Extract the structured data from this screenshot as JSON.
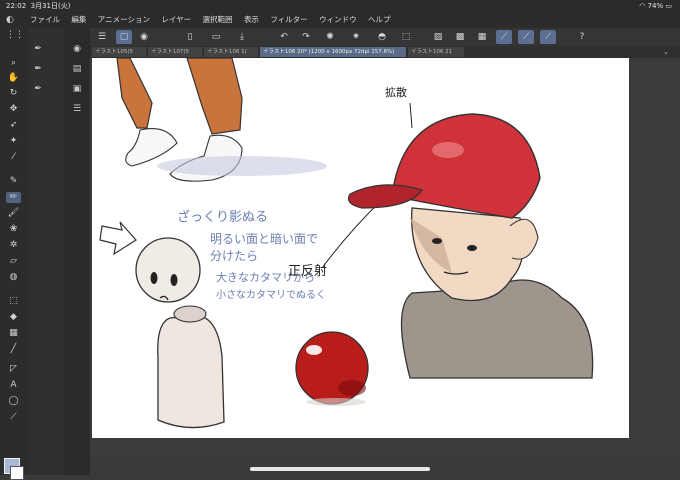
{
  "status": {
    "time": "22:02",
    "date": "3月31日(火)",
    "battery": "74%"
  },
  "menu": {
    "items": [
      "ファイル",
      "編集",
      "アニメーション",
      "レイヤー",
      "選択範囲",
      "表示",
      "フィルター",
      "ウィンドウ",
      "ヘルプ"
    ]
  },
  "tabs": [
    "イラスト105(5",
    "イラスト107(5",
    "イラスト106 1(",
    "イラスト106 20* (1200 x 1600px 72dpi 157.6%)",
    "イラスト106 21"
  ],
  "canvas_text": {
    "annotation_top": "拡散",
    "note_line1": "ざっくり影ぬる",
    "note_line2": "明るい面と暗い面で",
    "note_line3": "分けたら",
    "note_line4": "大きなカタマリから",
    "note_line5": "小さなカタマリでぬるく",
    "label_reflection": "正反射"
  },
  "colors": {
    "accent": "#5a6f92",
    "cap_red": "#d0323a",
    "sphere_red": "#b81d1a",
    "pants": "#c8743c",
    "hoodie": "#9e958c",
    "doll": "#efe6e0"
  }
}
